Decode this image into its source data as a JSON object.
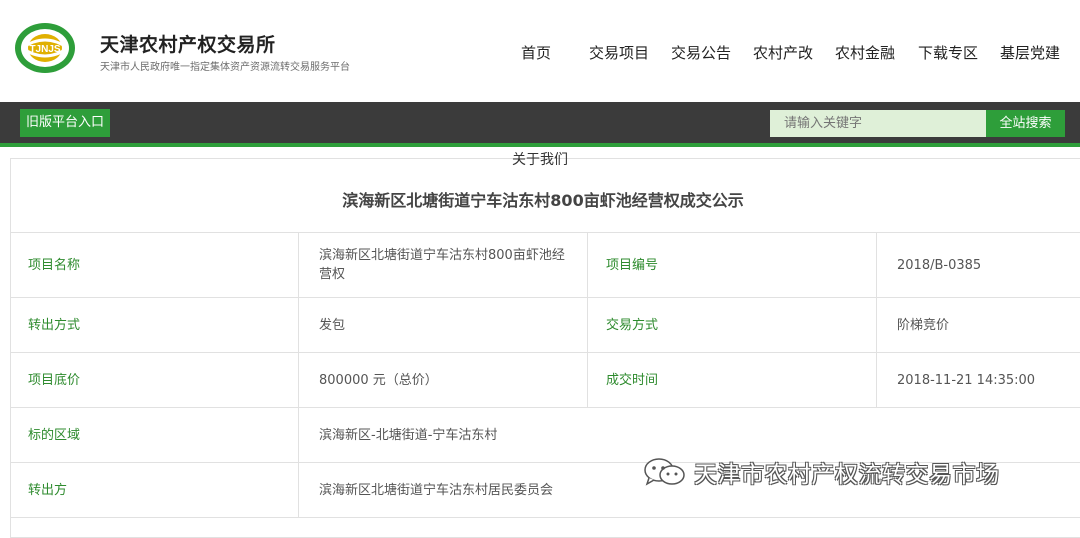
{
  "brand": {
    "title": "天津农村产权交易所",
    "subtitle": "天津市人民政府唯一指定集体资产资源流转交易服务平台",
    "logo_text": "TJNJS",
    "colors": {
      "green": "#2e9e3a",
      "gold": "#e0b000"
    }
  },
  "nav": {
    "items": [
      "首页",
      "交易项目",
      "交易公告",
      "农村产改",
      "农村金融",
      "下载专区",
      "基层党建"
    ]
  },
  "toolbar": {
    "old_platform_label": "旧版平台入口",
    "search_placeholder": "请输入关键字",
    "search_button_label": "全站搜索"
  },
  "section": {
    "breadcrumb": "关于我们",
    "title": "滨海新区北塘街道宁车沽东村800亩虾池经营权成交公示"
  },
  "table": {
    "rows": [
      {
        "label1": "项目名称",
        "value1": "滨海新区北塘街道宁车沽东村800亩虾池经营权",
        "label2": "项目编号",
        "value2": "2018/B-0385"
      },
      {
        "label1": "转出方式",
        "value1": "发包",
        "label2": "交易方式",
        "value2": "阶梯竞价"
      },
      {
        "label1": "项目底价",
        "value1": "800000 元（总价）",
        "label2": "成交时间",
        "value2": "2018-11-21 14:35:00"
      },
      {
        "label1": "标的区域",
        "value1": "滨海新区-北塘街道-宁车沽东村"
      },
      {
        "label1": "转出方",
        "value1": "滨海新区北塘街道宁车沽东村居民委员会"
      }
    ]
  },
  "watermark": {
    "text": "天津市农村产权流转交易市场",
    "icon": "wechat-icon"
  }
}
